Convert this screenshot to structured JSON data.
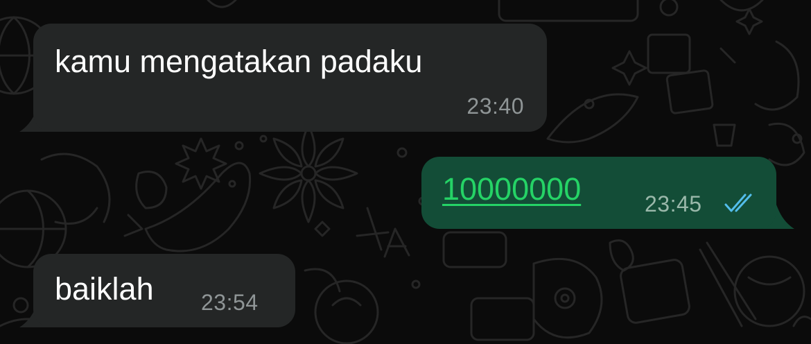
{
  "chat": {
    "messages": [
      {
        "direction": "incoming",
        "text": "kamu mengatakan padaku",
        "time": "23:40"
      },
      {
        "direction": "outgoing",
        "text": "10000000",
        "time": "23:45",
        "status_icon": "double-check-read-icon"
      },
      {
        "direction": "incoming",
        "text": "baiklah",
        "time": "23:54"
      }
    ]
  },
  "colors": {
    "background": "#0b0b0b",
    "wallpaper_doodle": "#2a2a2a",
    "incoming_bubble": "#242626",
    "outgoing_bubble": "#134d37",
    "link": "#25d366",
    "read_receipt": "#53bdeb",
    "timestamp": "#8f9596"
  }
}
